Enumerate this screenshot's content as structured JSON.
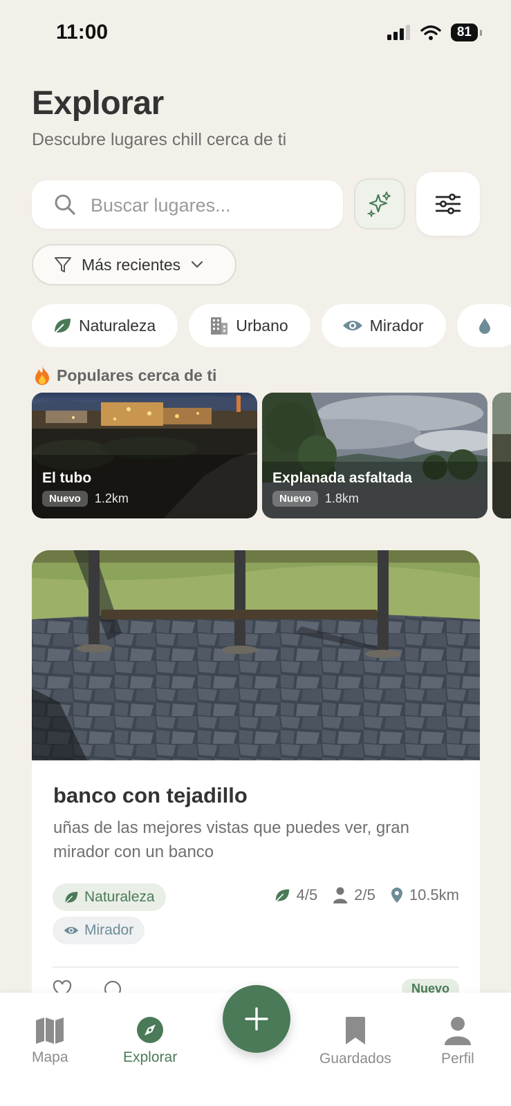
{
  "status_bar": {
    "time": "11:00",
    "battery": "81"
  },
  "header": {
    "title": "Explorar",
    "subtitle": "Descubre lugares chill cerca de ti"
  },
  "search": {
    "placeholder": "Buscar lugares..."
  },
  "sort": {
    "label": "Más recientes"
  },
  "categories": [
    {
      "label": "Naturaleza",
      "icon": "leaf-icon"
    },
    {
      "label": "Urbano",
      "icon": "building-icon"
    },
    {
      "label": "Mirador",
      "icon": "eye-icon"
    },
    {
      "label": "",
      "icon": "water-drop-icon"
    }
  ],
  "popular": {
    "heading": "Populares cerca de ti",
    "items": [
      {
        "name": "El tubo",
        "badge": "Nuevo",
        "distance": "1.2km"
      },
      {
        "name": "Explanada asfaltada",
        "badge": "Nuevo",
        "distance": "1.8km"
      }
    ]
  },
  "place": {
    "title": "banco con tejadillo",
    "description": "uñas de las mejores vistas que puedes ver, gran mirador con un banco",
    "tags": [
      "Naturaleza",
      "Mirador"
    ],
    "nature_rating": "4/5",
    "people_rating": "2/5",
    "distance": "10.5km",
    "badge": "Nuevo"
  },
  "tabbar": {
    "items": [
      {
        "label": "Mapa",
        "icon": "map-icon"
      },
      {
        "label": "Explorar",
        "icon": "compass-icon"
      },
      {
        "label": "Guardados",
        "icon": "bookmark-icon"
      },
      {
        "label": "Perfil",
        "icon": "person-icon"
      }
    ],
    "fab_icon": "plus-icon"
  },
  "colors": {
    "background": "#F3F0E9",
    "accent": "#4A7A57",
    "mirador": "#6D8C98"
  }
}
